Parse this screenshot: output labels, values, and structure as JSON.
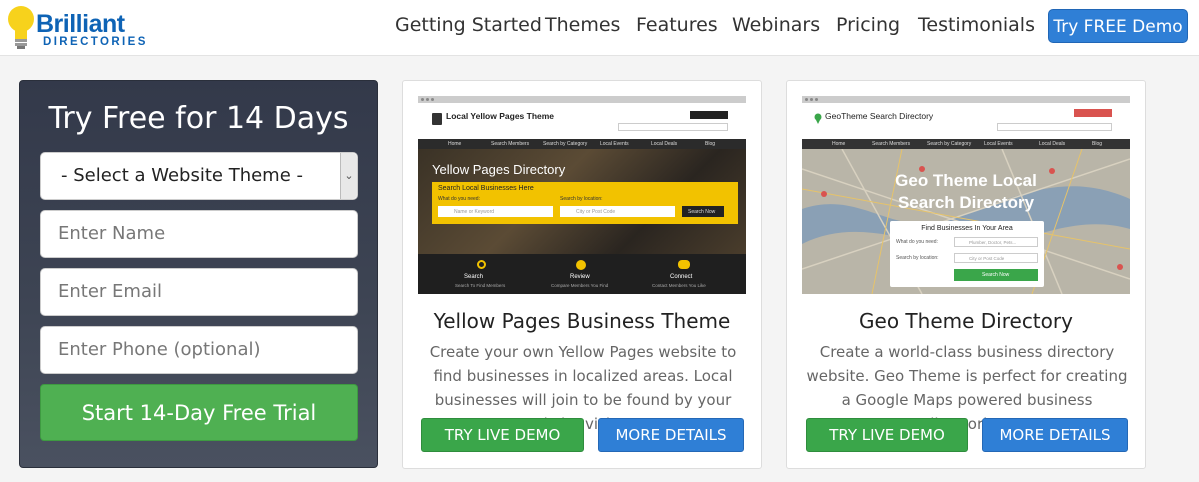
{
  "brand": {
    "name": "Brilliant",
    "sub": "DIRECTORIES"
  },
  "nav": [
    "Getting Started",
    "Themes",
    "Features",
    "Webinars",
    "Pricing",
    "Testimonials"
  ],
  "header_cta": "Try FREE Demo",
  "signup": {
    "title": "Try Free for 14 Days",
    "theme_select": "- Select a Website Theme -",
    "name_placeholder": "Enter Name",
    "email_placeholder": "Enter Email",
    "phone_placeholder": "Enter Phone (optional)",
    "submit": "Start 14-Day Free Trial"
  },
  "cards": [
    {
      "title": "Yellow Pages Business Theme",
      "desc": "Create your own Yellow Pages website to find businesses in localized areas. Local businesses will join to be found by your website visitors.",
      "demo": "TRY LIVE DEMO",
      "details": "MORE DETAILS",
      "preview": {
        "site": "Local Yellow Pages Theme",
        "tagline": "Yellow Pages Directory",
        "search_head": "Search Local Businesses Here",
        "need": "What do you need:",
        "loc": "Search by location:",
        "kw": "Name or Keyword",
        "city": "City or Post Code",
        "btn": "Search Now",
        "menu": [
          "Home",
          "Search Members",
          "Search by Category",
          "Local Events",
          "Local Deals",
          "Blog"
        ],
        "features": [
          {
            "label": "Search",
            "sub": "Search To Find Members"
          },
          {
            "label": "Review",
            "sub": "Compare Members You Find"
          },
          {
            "label": "Connect",
            "sub": "Contact Members You Like"
          }
        ]
      }
    },
    {
      "title": "Geo Theme Directory",
      "desc": "Create a world-class business directory website. Geo Theme is perfect for creating a Google Maps powered business directories.",
      "demo": "TRY LIVE DEMO",
      "details": "MORE DETAILS",
      "preview": {
        "site": "GeoTheme Search Directory",
        "tagline1": "Geo Theme Local",
        "tagline2": "Search Directory",
        "box_head": "Find Businesses In Your Area",
        "need": "What do you need:",
        "loc": "Search by location:",
        "kw": "Plumber, Doctor, Pets...",
        "city": "City or Post Code",
        "btn": "Search Now",
        "menu": [
          "Home",
          "Search Members",
          "Search by Category",
          "Local Events",
          "Local Deals",
          "Blog"
        ]
      }
    }
  ]
}
